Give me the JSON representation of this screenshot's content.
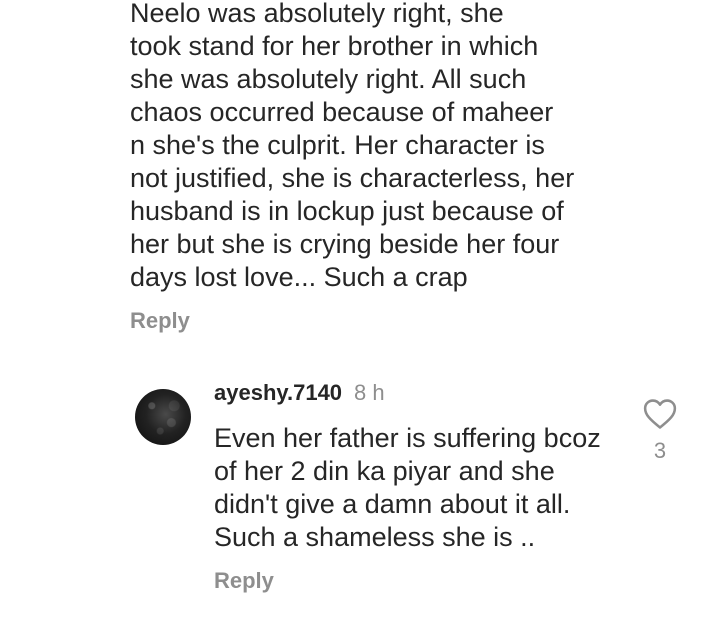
{
  "parent_comment": {
    "lines": [
      "Neelo was absolutely right, she",
      "took stand for her brother in which",
      "she was absolutely right. All such",
      "chaos occurred because of maheer",
      "n she's the culprit. Her character is",
      "not justified, she is characterless, her",
      "husband is in lockup just because of",
      "her but she is crying beside her four",
      "days lost love... Such a crap"
    ],
    "reply_label": "Reply"
  },
  "reply_comment": {
    "username": "ayeshy.7140",
    "time": "8 h",
    "lines": [
      "Even her father is suffering bcoz",
      "of her 2 din ka piyar and she",
      "didn't give a damn about it all.",
      "Such a shameless she is .."
    ],
    "reply_label": "Reply",
    "like_count": "3",
    "like_icon": "heart-outline-icon"
  }
}
